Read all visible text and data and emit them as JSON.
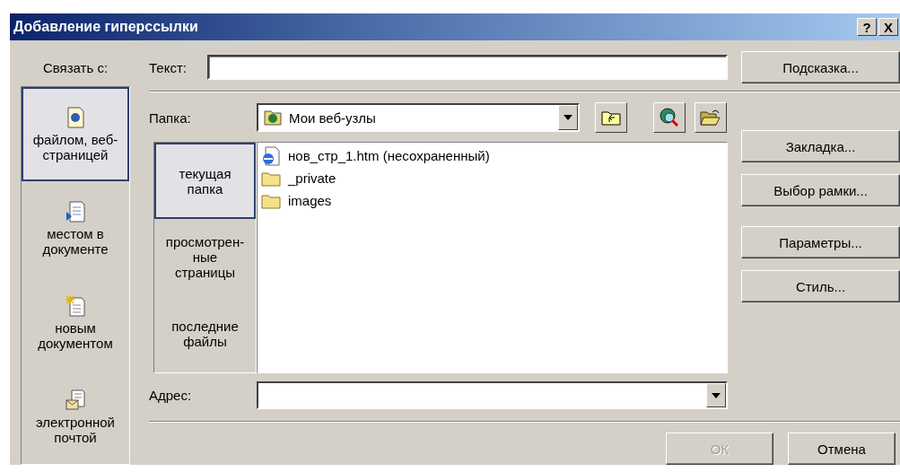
{
  "window": {
    "title": "Добавление гиперссылки",
    "title_buttons": [
      "?",
      "X"
    ]
  },
  "link_with": {
    "label": "Связать с:",
    "items": [
      {
        "label": "файлом, веб-страницей",
        "selected": true
      },
      {
        "label": "местом в документе",
        "selected": false
      },
      {
        "label": "новым документом",
        "selected": false
      },
      {
        "label": "электронной почтой",
        "selected": false
      }
    ]
  },
  "text_field": {
    "label": "Текст:"
  },
  "folder": {
    "label": "Папка:",
    "value": "Мои веб-узлы"
  },
  "places": [
    {
      "label": "текущая папка",
      "selected": true
    },
    {
      "label": "просмотрен-ные страницы",
      "selected": false
    },
    {
      "label": "последние файлы",
      "selected": false
    }
  ],
  "files": [
    {
      "name": "нов_стр_1.htm (несохраненный)",
      "kind": "page"
    },
    {
      "name": "_private",
      "kind": "folder"
    },
    {
      "name": "images",
      "kind": "folder"
    }
  ],
  "address_field": {
    "label": "Адрес:"
  },
  "side_buttons": [
    {
      "label": "Подсказка..."
    },
    {
      "label": "Закладка..."
    },
    {
      "label": "Выбор рамки..."
    },
    {
      "label": "Параметры..."
    },
    {
      "label": "Стиль..."
    }
  ],
  "buttons": [
    {
      "label": "ОК",
      "disabled": true
    },
    {
      "label": "Отмена",
      "disabled": false
    }
  ]
}
